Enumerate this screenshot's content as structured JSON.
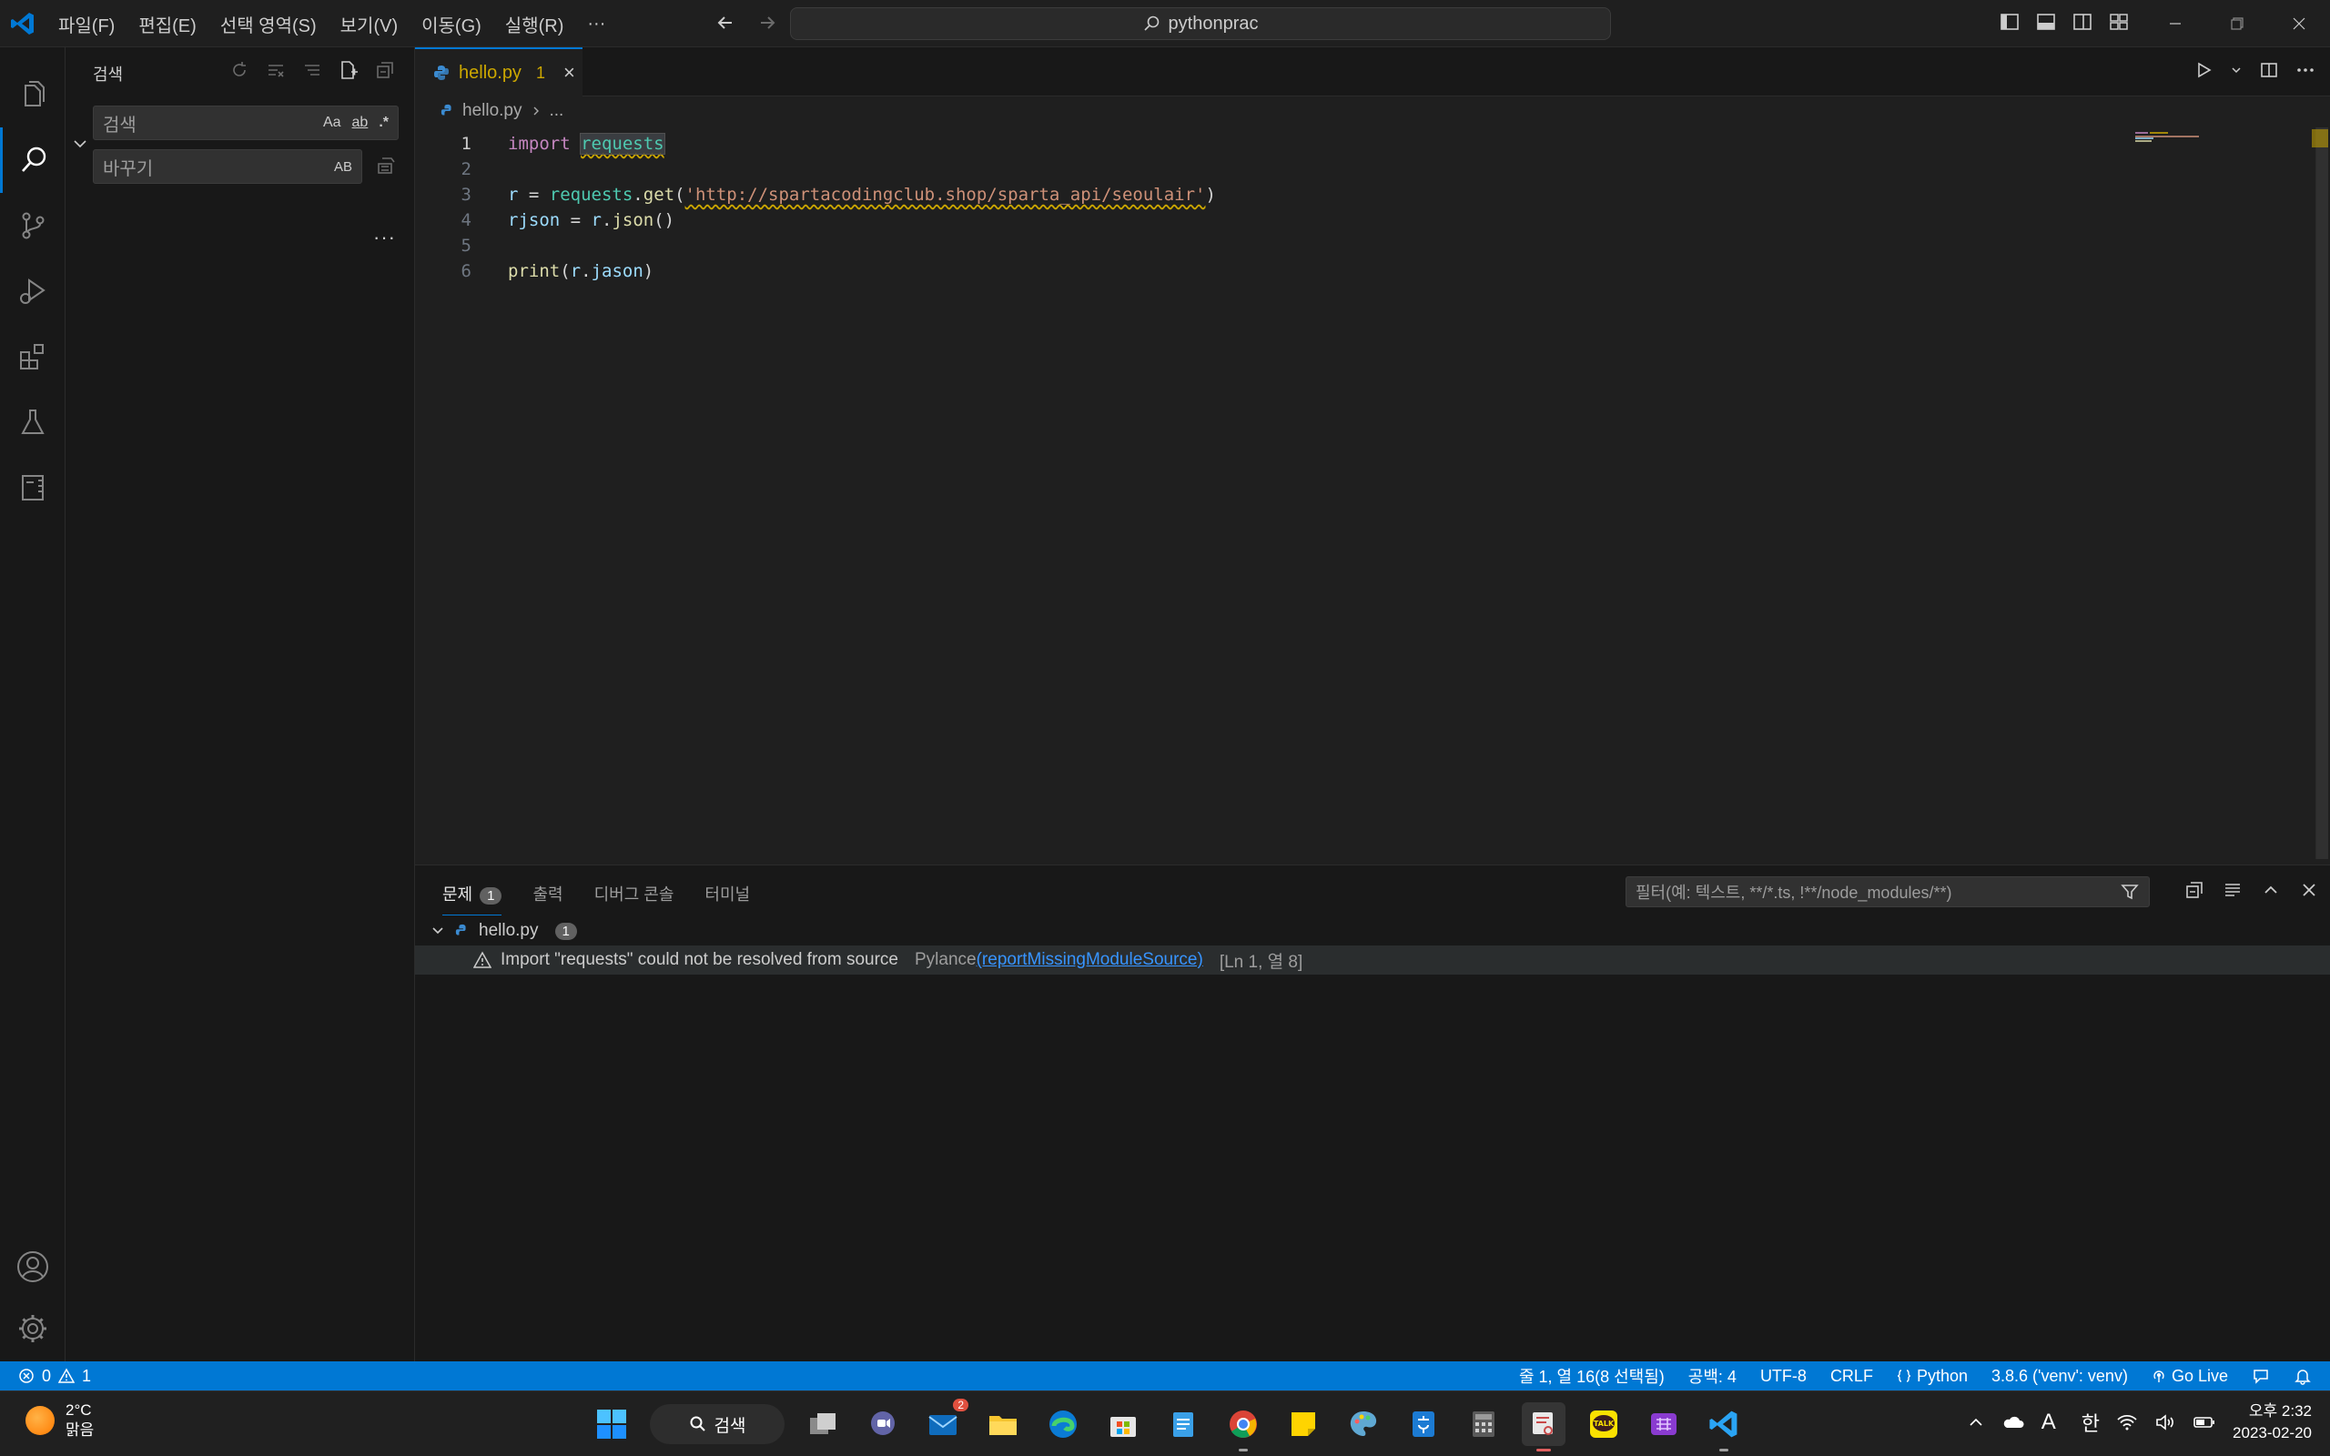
{
  "titlebar": {
    "menu": [
      "파일(F)",
      "편집(E)",
      "선택 영역(S)",
      "보기(V)",
      "이동(G)",
      "실행(R)",
      "···"
    ],
    "command_center": "pythonprac"
  },
  "activity_bar": {
    "items": [
      "explorer-icon",
      "search-icon",
      "source-control-icon",
      "run-debug-icon",
      "extensions-icon",
      "testing-icon",
      "notebook-icon"
    ],
    "bottom": [
      "accounts-icon",
      "settings-icon"
    ],
    "active": "search-icon"
  },
  "sidebar": {
    "title": "검색",
    "search_placeholder": "검색",
    "search_options": [
      "Aa",
      "ab",
      ".*"
    ],
    "replace_placeholder": "바꾸기",
    "replace_option": "AB",
    "more": "···"
  },
  "editor": {
    "tab": {
      "name": "hello.py",
      "problem_count": "1",
      "close": "×"
    },
    "breadcrumb": {
      "file": "hello.py",
      "rest": "..."
    },
    "lines": [
      {
        "num": "1",
        "t": [
          [
            "kw",
            "import"
          ],
          [
            "pl",
            " "
          ],
          [
            "modw",
            "requests"
          ]
        ]
      },
      {
        "num": "2",
        "t": []
      },
      {
        "num": "3",
        "t": [
          [
            "var",
            "r"
          ],
          [
            "pl",
            " = "
          ],
          [
            "mod",
            "requests"
          ],
          [
            "pl",
            "."
          ],
          [
            "fn",
            "get"
          ],
          [
            "pl",
            "("
          ],
          [
            "strw",
            "'http://spartacodingclub.shop/sparta_api/seoulair'"
          ],
          [
            "pl",
            ")"
          ]
        ]
      },
      {
        "num": "4",
        "t": [
          [
            "var",
            "rjson"
          ],
          [
            "pl",
            " = "
          ],
          [
            "var",
            "r"
          ],
          [
            "pl",
            "."
          ],
          [
            "fn",
            "json"
          ],
          [
            "pl",
            "()"
          ]
        ]
      },
      {
        "num": "5",
        "t": []
      },
      {
        "num": "6",
        "t": [
          [
            "fn",
            "print"
          ],
          [
            "pl",
            "("
          ],
          [
            "var",
            "r"
          ],
          [
            "pl",
            "."
          ],
          [
            "var",
            "jason"
          ],
          [
            "pl",
            ")"
          ]
        ]
      }
    ]
  },
  "panel": {
    "tabs": [
      {
        "label": "문제",
        "badge": "1"
      },
      {
        "label": "출력"
      },
      {
        "label": "디버그 콘솔"
      },
      {
        "label": "터미널"
      }
    ],
    "filter_placeholder": "필터(예: 텍스트, **/*.ts, !**/node_modules/**)",
    "problem_file": {
      "name": "hello.py",
      "count": "1"
    },
    "problem": {
      "message": "Import \"requests\" could not be resolved from source",
      "source": "Pylance",
      "code": "(reportMissingModuleSource)",
      "location": "[Ln 1, 열 8]"
    }
  },
  "statusbar": {
    "errors": "0",
    "warnings": "1",
    "cursor": "줄 1, 열 16(8 선택됨)",
    "spaces": "공백: 4",
    "encoding": "UTF-8",
    "eol": "CRLF",
    "language": "Python",
    "interpreter": "3.8.6 ('venv': venv)",
    "go_live": "Go Live"
  },
  "taskbar": {
    "weather_temp": "2°C",
    "weather_desc": "맑음",
    "search_label": "검색",
    "mail_badge": "2",
    "ime_mode": "A",
    "ime_lang": "한",
    "time": "오후 2:32",
    "date": "2023-02-20"
  }
}
